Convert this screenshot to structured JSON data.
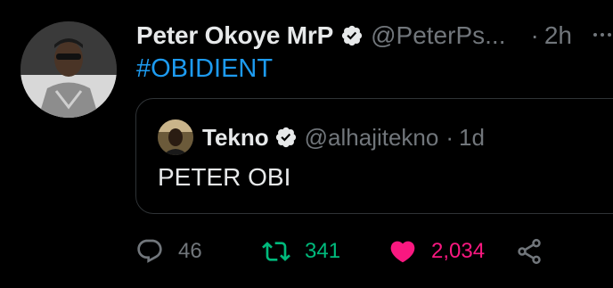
{
  "author": {
    "name": "Peter Okoye MrP",
    "handle": "@PeterPs...",
    "separator": "·",
    "time": "2h",
    "verified": true
  },
  "menu": {
    "icon": "more-icon",
    "label": "···"
  },
  "tweet": {
    "text": "#OBIDIENT"
  },
  "quoted": {
    "name": "Tekno",
    "handle": "@alhajitekno",
    "separator": "·",
    "time": "1d",
    "verified": true,
    "text": "PETER OBI"
  },
  "actions": {
    "reply_count": "46",
    "retweet_count": "341",
    "like_count": "2,034",
    "liked": true,
    "retweeted": true
  },
  "colors": {
    "background": "#000000",
    "text": "#e7e9ea",
    "muted": "#71767b",
    "link": "#1d9bf0",
    "retweet": "#00ba7c",
    "like": "#f91880",
    "border": "#2f3336"
  }
}
